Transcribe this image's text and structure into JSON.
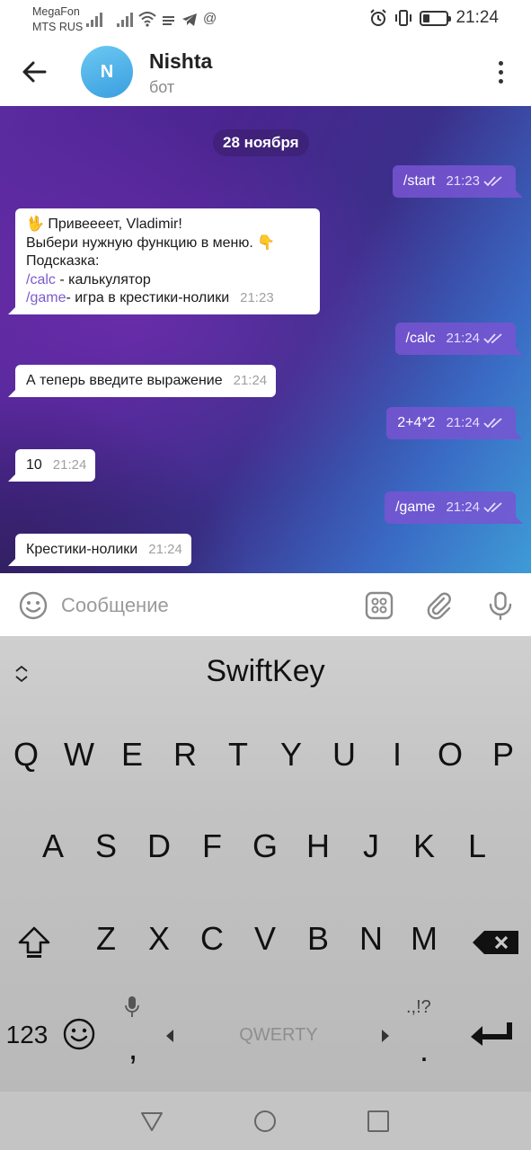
{
  "status_bar": {
    "carrier_1": "MegaFon",
    "carrier_2": "MTS RUS",
    "time": "21:24",
    "battery_level": 0.3
  },
  "header": {
    "avatar_letter": "N",
    "title": "Nishta",
    "subtitle": "бот"
  },
  "chat": {
    "date": "28 ноября",
    "messages": {
      "m1": {
        "text": "/start",
        "time": "21:23"
      },
      "m2": {
        "line1": "🖖 Привеееет, Vladimir!",
        "line2": "Выбери нужную функцию в меню. 👇",
        "line3": "Подсказка:",
        "calc_cmd": "/calc",
        "calc_desc": " - калькулятор",
        "game_cmd": "/game",
        "game_desc": " - игра в крестики-нолики",
        "time": "21:23"
      },
      "m3": {
        "text": "/calc",
        "time": "21:24"
      },
      "m4": {
        "text": "А теперь введите выражение",
        "time": "21:24"
      },
      "m5": {
        "text": "2+4*2",
        "time": "21:24"
      },
      "m6": {
        "text": "10",
        "time": "21:24"
      },
      "m7": {
        "text": "/game",
        "time": "21:24"
      },
      "m8": {
        "text": "Крестики-нолики",
        "time": "21:24"
      }
    }
  },
  "composer": {
    "placeholder": "Сообщение"
  },
  "keyboard": {
    "brand": "SwiftKey",
    "row1": [
      "Q",
      "W",
      "E",
      "R",
      "T",
      "Y",
      "U",
      "I",
      "O",
      "P"
    ],
    "row2": [
      "A",
      "S",
      "D",
      "F",
      "G",
      "H",
      "J",
      "K",
      "L"
    ],
    "row3": [
      "Z",
      "X",
      "C",
      "V",
      "B",
      "N",
      "M"
    ],
    "numbers_label": "123",
    "comma_label": ",",
    "space_label": "QWERTY",
    "punct_hint": ".,!?",
    "period_label": "."
  },
  "colors": {
    "outgoing_bubble": "#7855d2",
    "command_link": "#7b5cc9",
    "avatar": "#4aaee8"
  }
}
